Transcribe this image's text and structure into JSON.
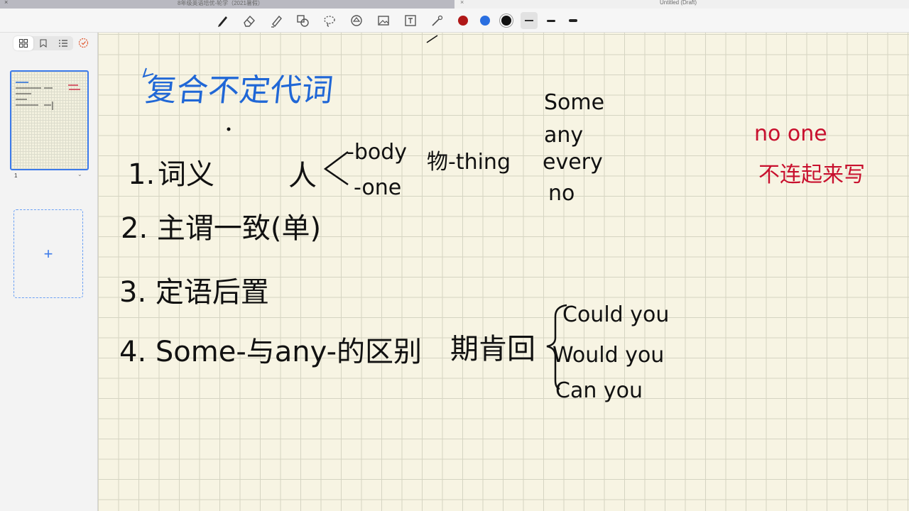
{
  "window": {
    "left_title": "8年级英语培优-轮学（2021暑假）",
    "right_title": "Untitled (Draft)"
  },
  "toolbar": {
    "tools": [
      "pen-icon",
      "eraser-icon",
      "highlighter-icon",
      "shapes-icon",
      "lasso-icon",
      "sticker-icon",
      "image-icon",
      "text-icon",
      "laser-pointer-icon"
    ],
    "colors": [
      "#b01818",
      "#2a6fe0",
      "#111111"
    ],
    "stroke_sizes": [
      "thin",
      "medium",
      "thick"
    ]
  },
  "sidebar": {
    "page_number": "1",
    "add_page_label": "+"
  },
  "notes": {
    "title": "复合不定代词",
    "item1_num": "1.",
    "item1_text": "词义",
    "person": "人",
    "body": "-body",
    "one": "-one",
    "thing_label": "物-thing",
    "prefixes": [
      "Some",
      "any",
      "every",
      "no"
    ],
    "item2": "2. 主谓一致(单)",
    "item3": "3. 定语后置",
    "item4": "4. Some-与any-的区别",
    "expect": "期肯回",
    "phrases": [
      "Could you",
      "Would you",
      "Can you"
    ],
    "red_line1": "no one",
    "red_line2": "不连起来写"
  }
}
